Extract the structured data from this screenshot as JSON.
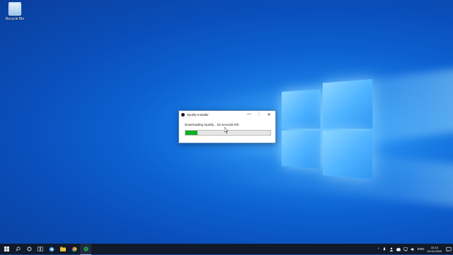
{
  "desktop": {
    "recycle_bin_label": "Recycle Bin"
  },
  "installer": {
    "title": "Spotify Installer",
    "status_text": "Downloading Spotify... 53 seconds left",
    "progress": 0.14,
    "buttons": {
      "minimize": "—",
      "maximize": "□",
      "close": "✕"
    }
  },
  "taskbar": {
    "items": [
      "windows-start-icon",
      "search-icon",
      "cortana-icon",
      "task-view-icon",
      "edge-icon",
      "file-explorer-icon",
      "chrome-icon",
      "spotify-installer-icon"
    ],
    "tray": {
      "language": "ENG",
      "time": "22:13",
      "date": "02-02-2020"
    }
  },
  "colors": {
    "progress_fill": "#06b025",
    "taskbar": "#101a2a"
  }
}
